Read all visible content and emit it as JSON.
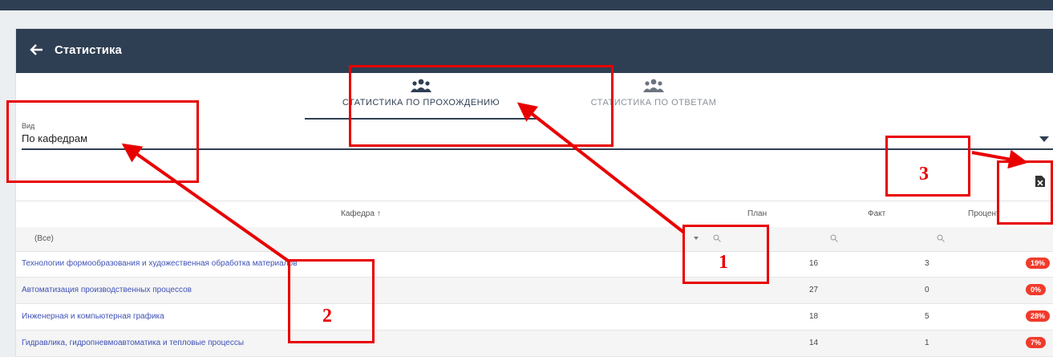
{
  "header": {
    "title": "Статистика"
  },
  "tabs": [
    {
      "label": "СТАТИСТИКА ПО ПРОХОЖДЕНИЮ",
      "active": true
    },
    {
      "label": "СТАТИСТИКА ПО ОТВЕТАМ",
      "active": false
    }
  ],
  "view_select": {
    "label": "Вид",
    "value": "По кафедрам"
  },
  "table": {
    "columns": [
      "Кафедра ↑",
      "План",
      "Факт",
      "Процент"
    ],
    "filter_value": "(Все)",
    "rows": [
      {
        "name": "Технологии формообразования и художественная обработка материалов",
        "plan": "16",
        "fact": "3",
        "percent": "19%"
      },
      {
        "name": "Автоматизация производственных процессов",
        "plan": "27",
        "fact": "0",
        "percent": "0%"
      },
      {
        "name": "Инженерная и компьютерная графика",
        "plan": "18",
        "fact": "5",
        "percent": "28%"
      },
      {
        "name": "Гидравлика, гидропневмоавтоматика и тепловые процессы",
        "plan": "14",
        "fact": "1",
        "percent": "7%"
      }
    ]
  },
  "annotations": {
    "one": "1",
    "two": "2",
    "three": "3"
  },
  "colors": {
    "header": "#2f3f53",
    "link": "#3f51b5",
    "badge": "#f03b2c",
    "annotation": "#e80000"
  },
  "icons": {
    "back": "arrow-left-icon",
    "tab": "people-group-icon",
    "export": "excel-export-icon",
    "filter": "search-icon",
    "dropdown": "caret-down-icon",
    "sort": "arrow-up-icon"
  }
}
